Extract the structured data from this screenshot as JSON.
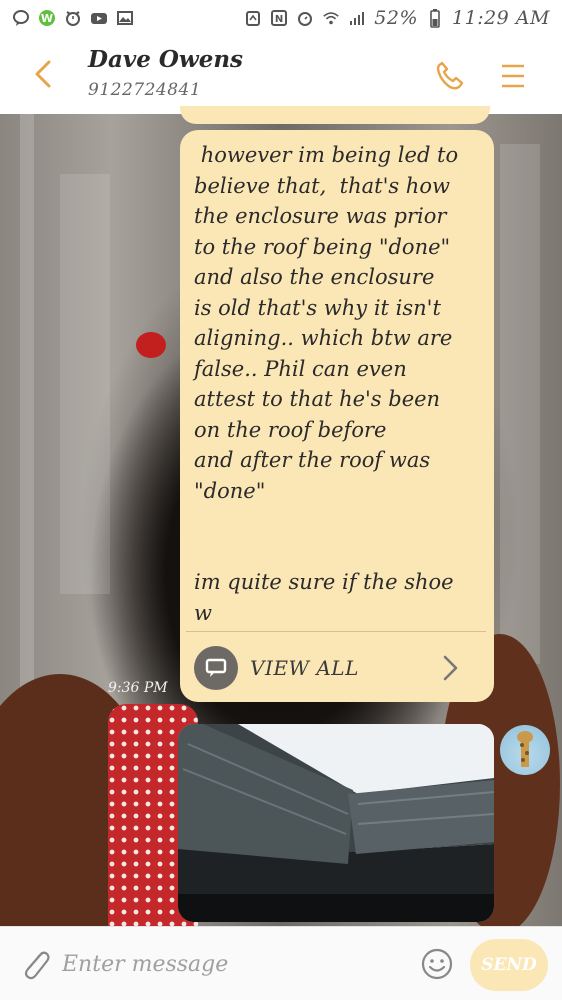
{
  "status_bar": {
    "battery": "52%",
    "time": "11:29 AM",
    "left_icons": [
      "chat-icon",
      "w-app-icon",
      "alarm-icon",
      "youtube-icon",
      "gallery-icon"
    ],
    "right_icons": [
      "recycle-icon",
      "nfc-icon",
      "alarm-icon",
      "wifi-icon",
      "signal-icon"
    ]
  },
  "header": {
    "contact_name": "Dave Owens",
    "phone_number": "9122724841",
    "accent_color": "#e8a44a"
  },
  "message": {
    "text": " however im being led to\nbelieve that,  that's how\nthe enclosure was prior\nto the roof being \"done\"\nand also the enclosure\nis old that's why it isn't\naligning.. which btw are\nfalse.. Phil can even\nattest to that he's been\non the roof before\nand after the roof was\n\"done\"\n\n\nim quite sure if the shoe\nw",
    "view_all_label": "VIEW ALL",
    "timestamp": "9:36 PM",
    "bubble_color": "#fbe6b6"
  },
  "composer": {
    "placeholder": "Enter message",
    "send_label": "SEND"
  }
}
